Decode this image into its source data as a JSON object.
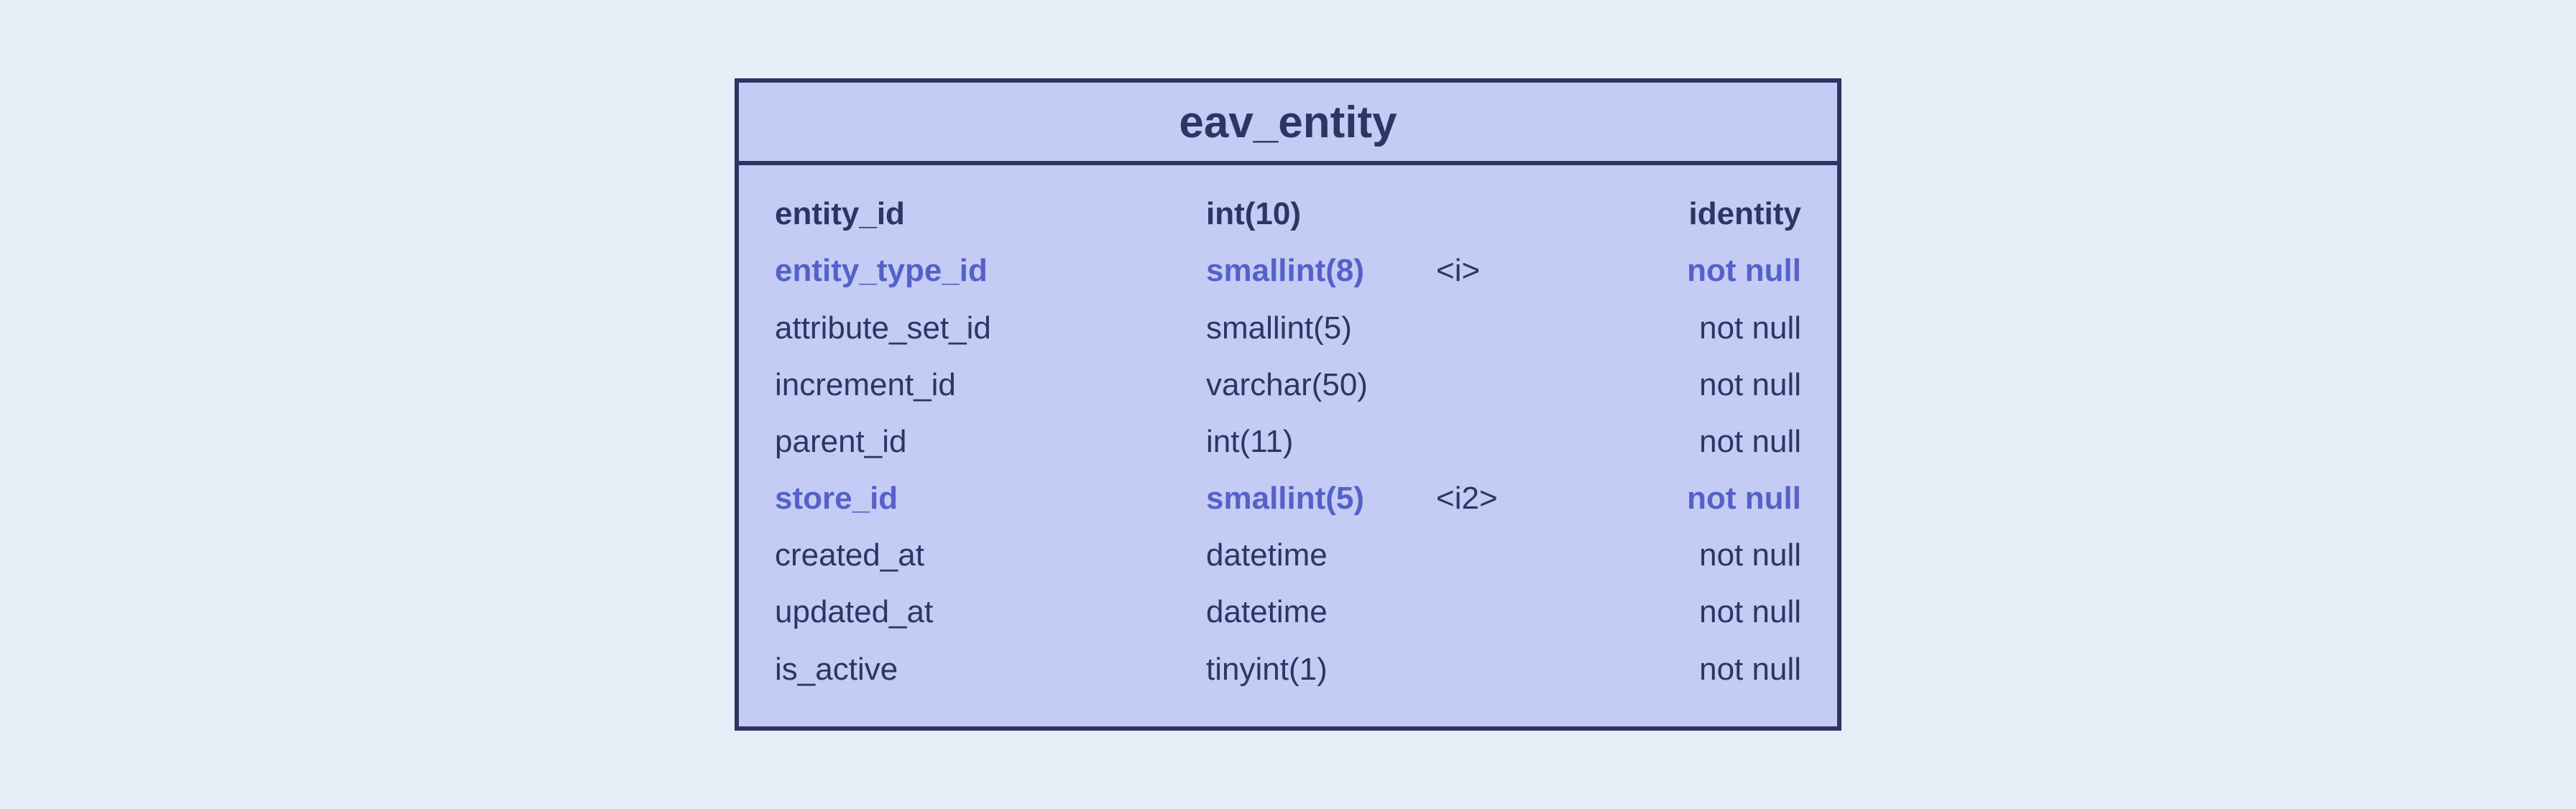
{
  "table": {
    "title": "eav_entity",
    "columns": [
      {
        "name": "entity_id",
        "type": "int(10)",
        "index": "",
        "constraint": "identity",
        "header": true,
        "highlight": false
      },
      {
        "name": "entity_type_id",
        "type": "smallint(8)",
        "index": "<i>",
        "constraint": "not null",
        "header": false,
        "highlight": true
      },
      {
        "name": "attribute_set_id",
        "type": "smallint(5)",
        "index": "",
        "constraint": "not null",
        "header": false,
        "highlight": false
      },
      {
        "name": "increment_id",
        "type": "varchar(50)",
        "index": "",
        "constraint": "not null",
        "header": false,
        "highlight": false
      },
      {
        "name": "parent_id",
        "type": "int(11)",
        "index": "",
        "constraint": "not null",
        "header": false,
        "highlight": false
      },
      {
        "name": "store_id",
        "type": "smallint(5)",
        "index": "<i2>",
        "constraint": "not null",
        "header": false,
        "highlight": true
      },
      {
        "name": "created_at",
        "type": "datetime",
        "index": "",
        "constraint": "not null",
        "header": false,
        "highlight": false
      },
      {
        "name": "updated_at",
        "type": "datetime",
        "index": "",
        "constraint": "not null",
        "header": false,
        "highlight": false
      },
      {
        "name": "is_active",
        "type": "tinyint(1)",
        "index": "",
        "constraint": "not null",
        "header": false,
        "highlight": false
      }
    ]
  }
}
